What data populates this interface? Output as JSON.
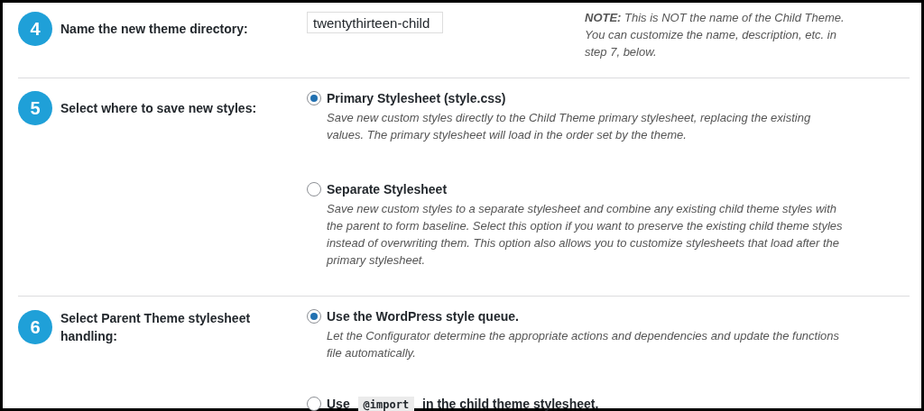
{
  "steps": [
    {
      "number": "4",
      "label": "Name the new theme directory:",
      "kind": "text",
      "field": {
        "value": "twentythirteen-child"
      },
      "note": "**NOTE:** This is NOT the name of the Child Theme. You can customize the name, description, etc. in step 7, below."
    },
    {
      "number": "5",
      "label": "Select where to save new styles:",
      "kind": "radio",
      "options": [
        {
          "selected": true,
          "label": [
            {
              "kind": "text",
              "text": "Primary Stylesheet (style.css)"
            }
          ],
          "description": "Save new custom styles directly to the Child Theme primary stylesheet, replacing the existing values. The primary stylesheet will load in the order set by the theme."
        },
        {
          "selected": false,
          "label": [
            {
              "kind": "text",
              "text": "Separate Stylesheet"
            }
          ],
          "description": "Save new custom styles to a separate stylesheet and combine any existing child theme styles with the parent to form baseline. Select this option if you want to preserve the existing child theme styles instead of overwriting them. This option also allows you to customize stylesheets that load after the primary stylesheet."
        }
      ]
    },
    {
      "number": "6",
      "label": "Select Parent Theme stylesheet handling:",
      "kind": "radio",
      "options": [
        {
          "selected": true,
          "label": [
            {
              "kind": "text",
              "text": "Use the WordPress style queue."
            }
          ],
          "description": "Let the Configurator determine the appropriate actions and dependencies and update the functions file automatically."
        },
        {
          "selected": false,
          "label": [
            {
              "kind": "text",
              "text": "Use"
            },
            {
              "kind": "code",
              "text": "@import"
            },
            {
              "kind": "text",
              "text": "in the child theme stylesheet."
            }
          ]
        }
      ]
    }
  ]
}
